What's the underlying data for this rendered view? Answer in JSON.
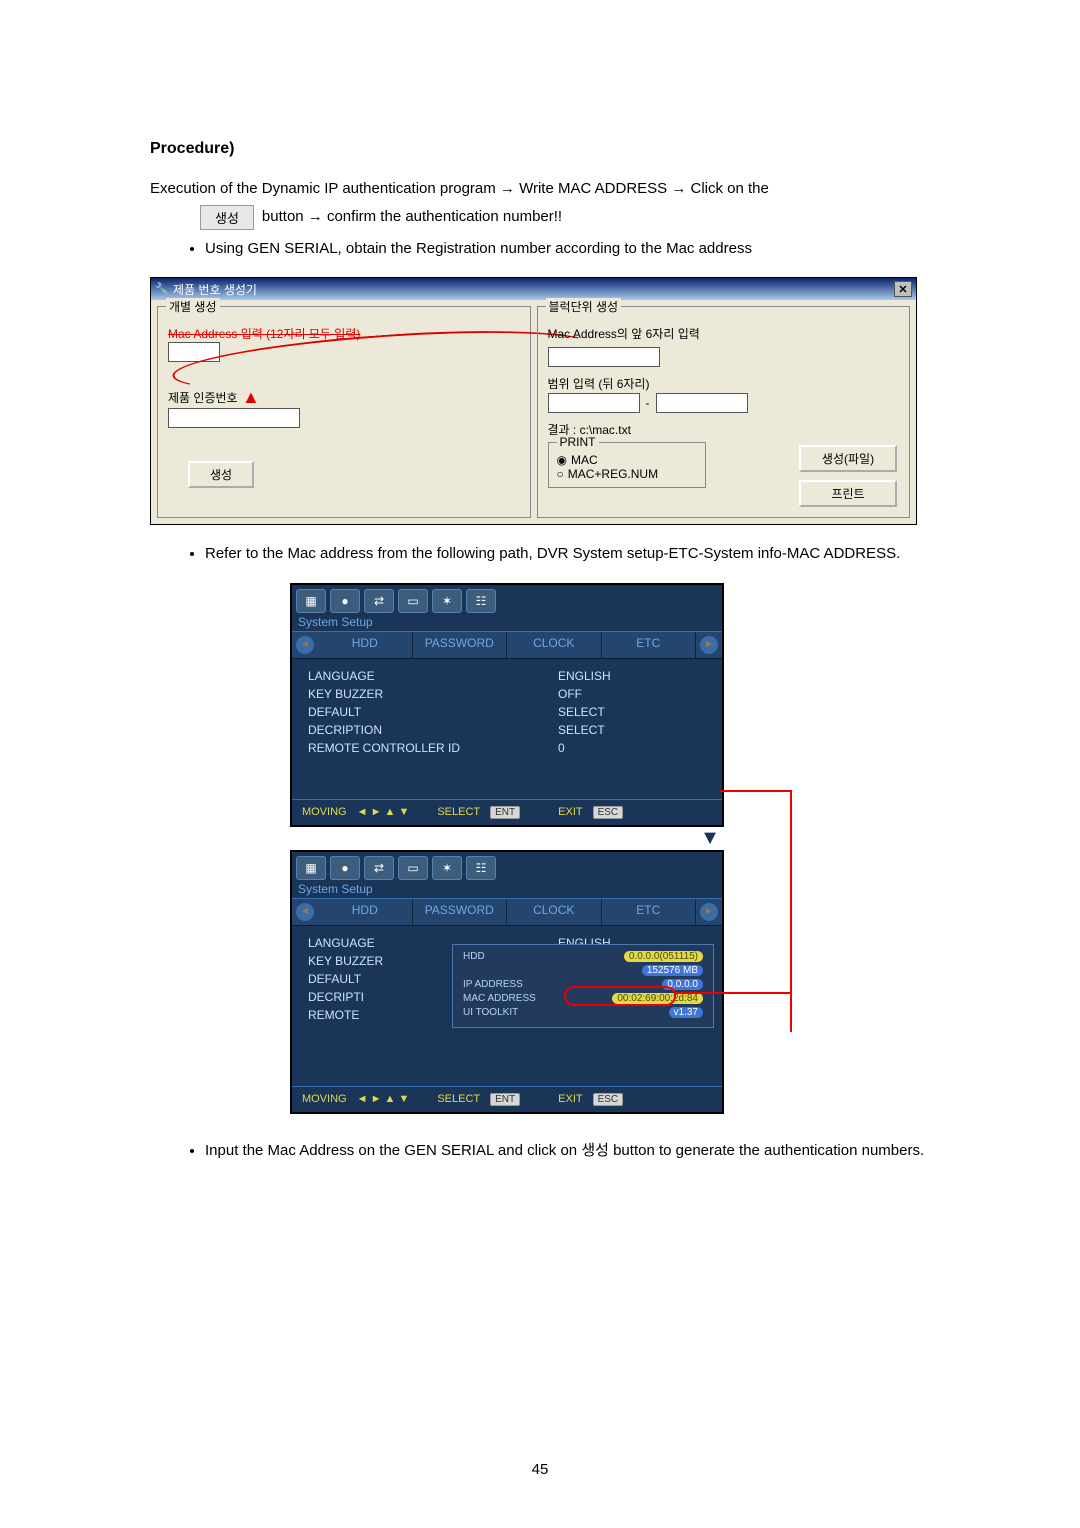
{
  "heading": "Procedure)",
  "intro_line": "Execution of the Dynamic IP authentication program → Write MAC ADDRESS → Click on the",
  "gen_button_label": "생성",
  "after_button": "button → confirm the authentication number!!",
  "bullet1": "Using GEN SERIAL, obtain the Registration number according to the Mac address",
  "dialog": {
    "title": "제품 번호 생성기",
    "left_group": "개별 생성",
    "mac_label_strike": "Mac Address 입력 (12자리 모두 입력)",
    "cert_label": "제품 인증번호",
    "gen_button": "생성",
    "right_group": "블럭단위 생성",
    "mac_front": "Mac Address의 앞 6자리 입력",
    "range_label": "범위 입력 (뒤 6자리)",
    "range_sep": "-",
    "result": "결과 : c:\\mac.txt",
    "print_group": "PRINT",
    "radio1": "MAC",
    "radio2": "MAC+REG.NUM",
    "btn_genfile": "생성(파일)",
    "btn_print": "프린트"
  },
  "bullet2": "Refer to the Mac address from the following path, DVR System setup-ETC-System info-MAC ADDRESS.",
  "dvr": {
    "system_setup": "System Setup",
    "tabs": {
      "hdd": "HDD",
      "password": "PASSWORD",
      "clock": "CLOCK",
      "etc": "ETC"
    },
    "rows": {
      "language": "LANGUAGE",
      "language_val": "ENGLISH",
      "keybuzzer": "KEY BUZZER",
      "keybuzzer_val": "OFF",
      "default": "DEFAULT",
      "default_val": "SELECT",
      "decription": "DECRIPTION",
      "decription_val": "SELECT",
      "remote": "REMOTE CONTROLLER ID",
      "remote_val": "0"
    },
    "footer": {
      "moving": "MOVING",
      "select": "SELECT",
      "exit": "EXIT",
      "ent": "ENT",
      "esc": "ESC"
    },
    "popup": {
      "hdd": "HDD",
      "hdd_val": "0.0.0.0(051115)",
      "hdd_size": "152576 MB",
      "ip": "IP ADDRESS",
      "ip_val": "0.0.0.0",
      "mac": "MAC ADDRESS",
      "mac_val": "00:02:69:00:2d:84",
      "toolkit": "UI TOOLKIT",
      "toolkit_val": "v1.37"
    },
    "rows2": {
      "language": "LANGUAGE",
      "language_val": "ENGLISH",
      "keybuzzer": "KEY BUZZER",
      "default": "DEFAULT",
      "decripti": "DECRIPTI",
      "remote": "REMOTE"
    }
  },
  "bullet3_pre": "Input the Mac Address on the GEN SERIAL and click on ",
  "bullet3_btn": "생성",
  "bullet3_post": " button to generate the authentication numbers.",
  "page_number": "45"
}
